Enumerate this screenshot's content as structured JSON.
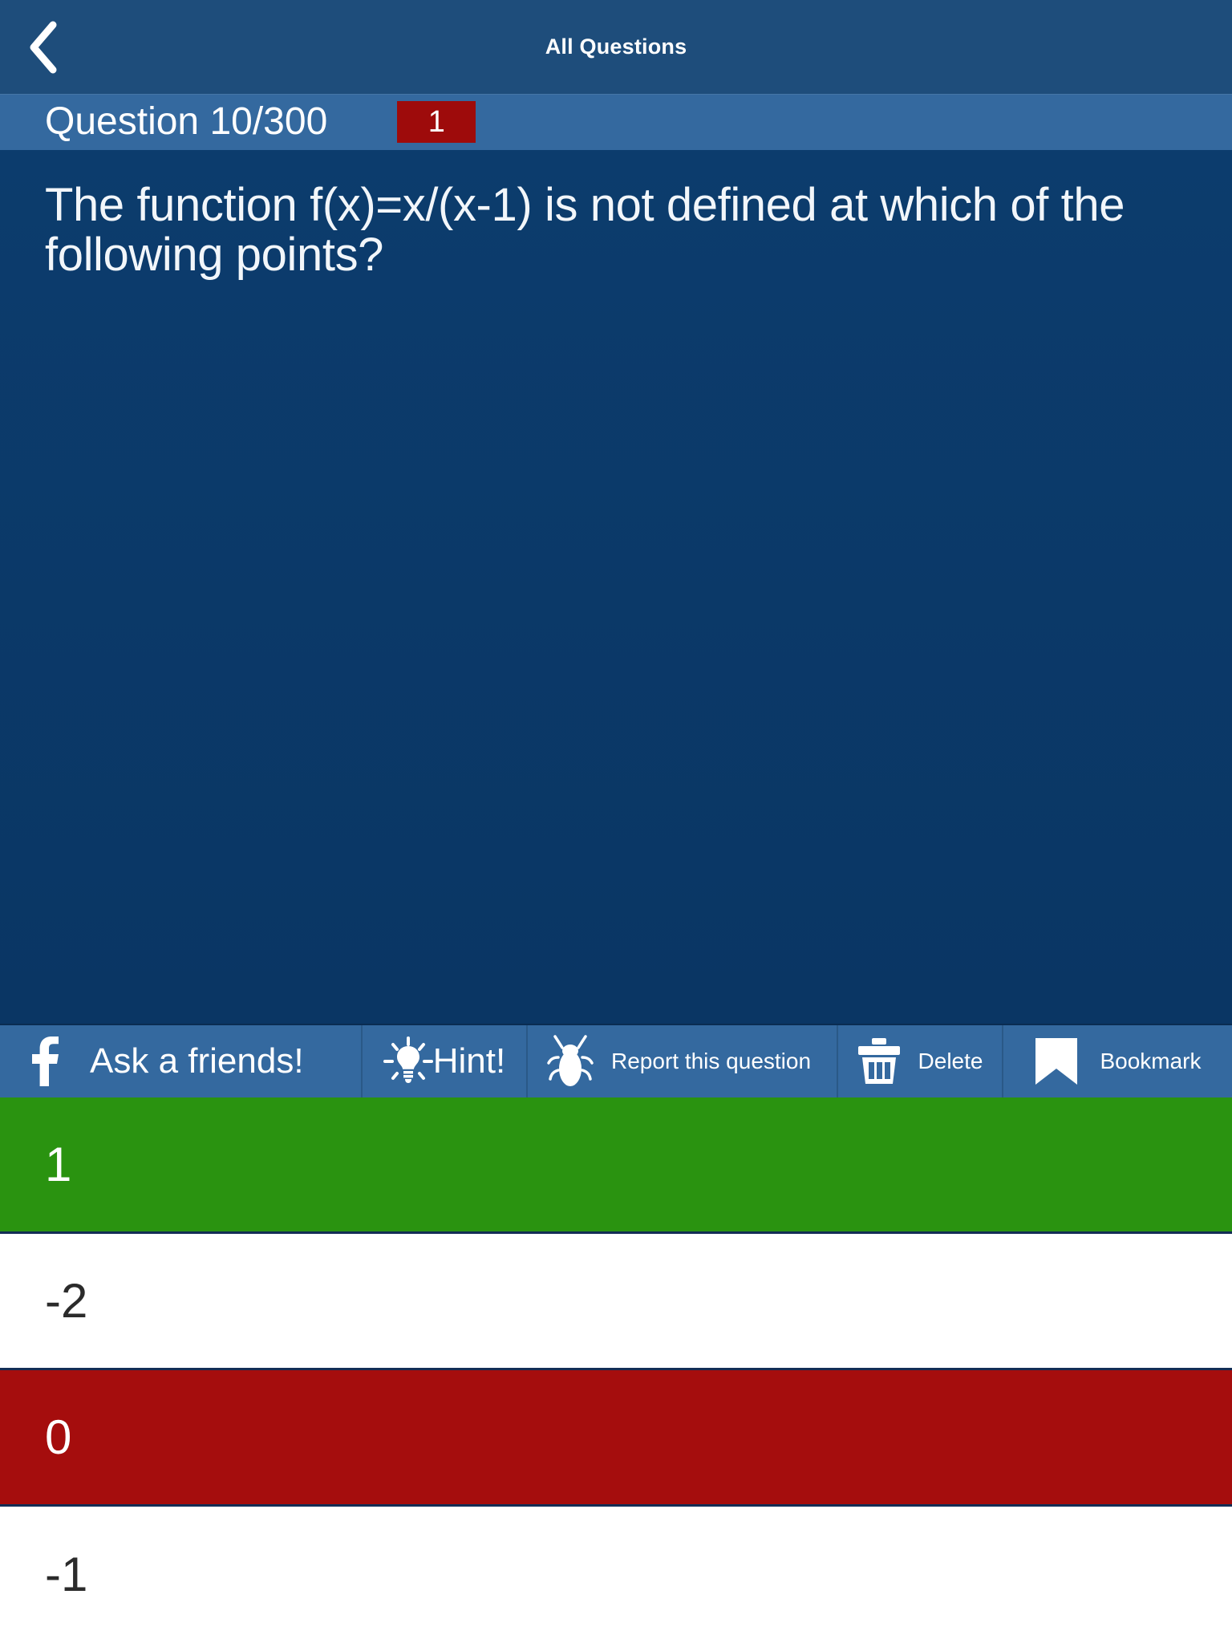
{
  "navbar": {
    "back_icon": "chevron-left-icon",
    "title": "All Questions"
  },
  "question_header": {
    "label": "Question 10/300",
    "badge": "1",
    "badge_color": "#9e0b0b"
  },
  "question": {
    "text": "The function f(x)=x/(x-1) is not defined at which of the following points?"
  },
  "toolbar": {
    "items": [
      {
        "id": "ask-a-friend",
        "label": "Ask a friends!",
        "icon": "facebook-icon"
      },
      {
        "id": "hint",
        "label": "Hint!",
        "icon": "lightbulb-icon"
      },
      {
        "id": "report",
        "label": "Report this question",
        "icon": "bug-icon"
      },
      {
        "id": "delete",
        "label": "Delete",
        "icon": "trash-icon"
      },
      {
        "id": "bookmark",
        "label": "Bookmark",
        "icon": "bookmark-icon"
      }
    ]
  },
  "answers": {
    "options": [
      {
        "label": "1",
        "state": "correct"
      },
      {
        "label": "-2",
        "state": "neutral"
      },
      {
        "label": "0",
        "state": "wrong"
      },
      {
        "label": "-1",
        "state": "neutral"
      }
    ]
  },
  "colors": {
    "navbar_bg": "#1e4d7b",
    "header_bg": "#34699f",
    "body_bg": "#0b3b6b",
    "toolbar_bg": "#34699f",
    "correct_green": "#2a9310",
    "wrong_red": "#a50d0d",
    "neutral_white": "#ffffff"
  }
}
